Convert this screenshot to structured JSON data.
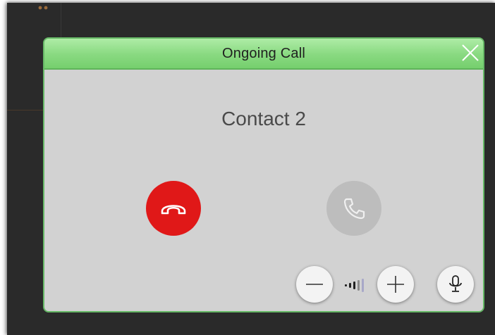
{
  "dialog": {
    "title": "Ongoing Call",
    "contact_name": "Contact 2"
  },
  "icons": {
    "close": "close-icon",
    "hangup": "phone-hangup-icon",
    "answer": "phone-answer-icon",
    "volume_down": "minus-icon",
    "volume_up": "plus-icon",
    "volume_level": "volume-level-icon",
    "microphone": "microphone-icon"
  },
  "volume": {
    "level_bars_filled": 3,
    "level_bars_total": 5
  },
  "colors": {
    "header_green": "#88d980",
    "dialog_border": "#66b866",
    "hangup_red": "#e01818",
    "answer_disabled_gray": "#bdbdbd",
    "dialog_body": "#d2d2d2",
    "background_dark": "#2a2a2a"
  }
}
